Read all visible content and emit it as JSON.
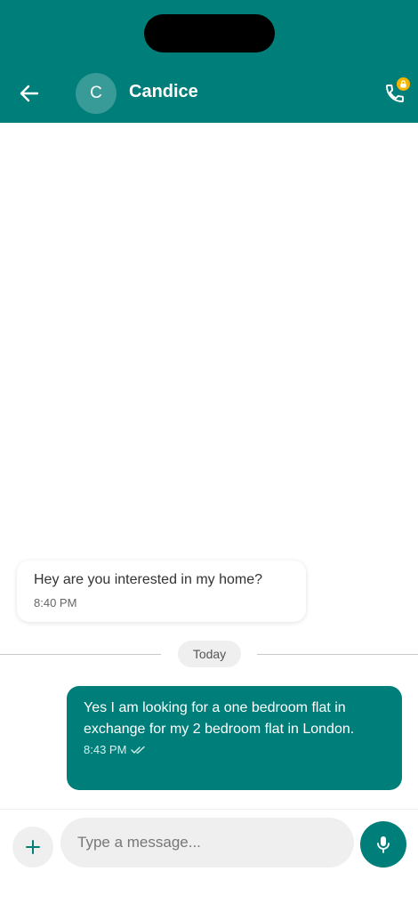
{
  "header": {
    "contact_initial": "C",
    "contact_name": "Candice",
    "icons": {
      "back": "arrow-left-icon",
      "call": "phone-icon",
      "badge": "lock-icon"
    }
  },
  "messages": [
    {
      "direction": "incoming",
      "text": "Hey are you interested in my home?",
      "time": "8:40 PM"
    },
    {
      "direction": "outgoing",
      "text": "Yes I am looking for a one bedroom flat in exchange for my 2 bedroom flat in London.",
      "time": "8:43 PM",
      "status": "double-check-icon"
    }
  ],
  "date_divider": "Today",
  "composer": {
    "placeholder": "Type a message...",
    "value": "",
    "icons": {
      "attach": "plus-icon",
      "voice": "microphone-icon"
    }
  },
  "colors": {
    "primary": "#007f7a",
    "badge": "#f5b400",
    "bubble_in": "#ffffff",
    "pill": "#efefef"
  }
}
